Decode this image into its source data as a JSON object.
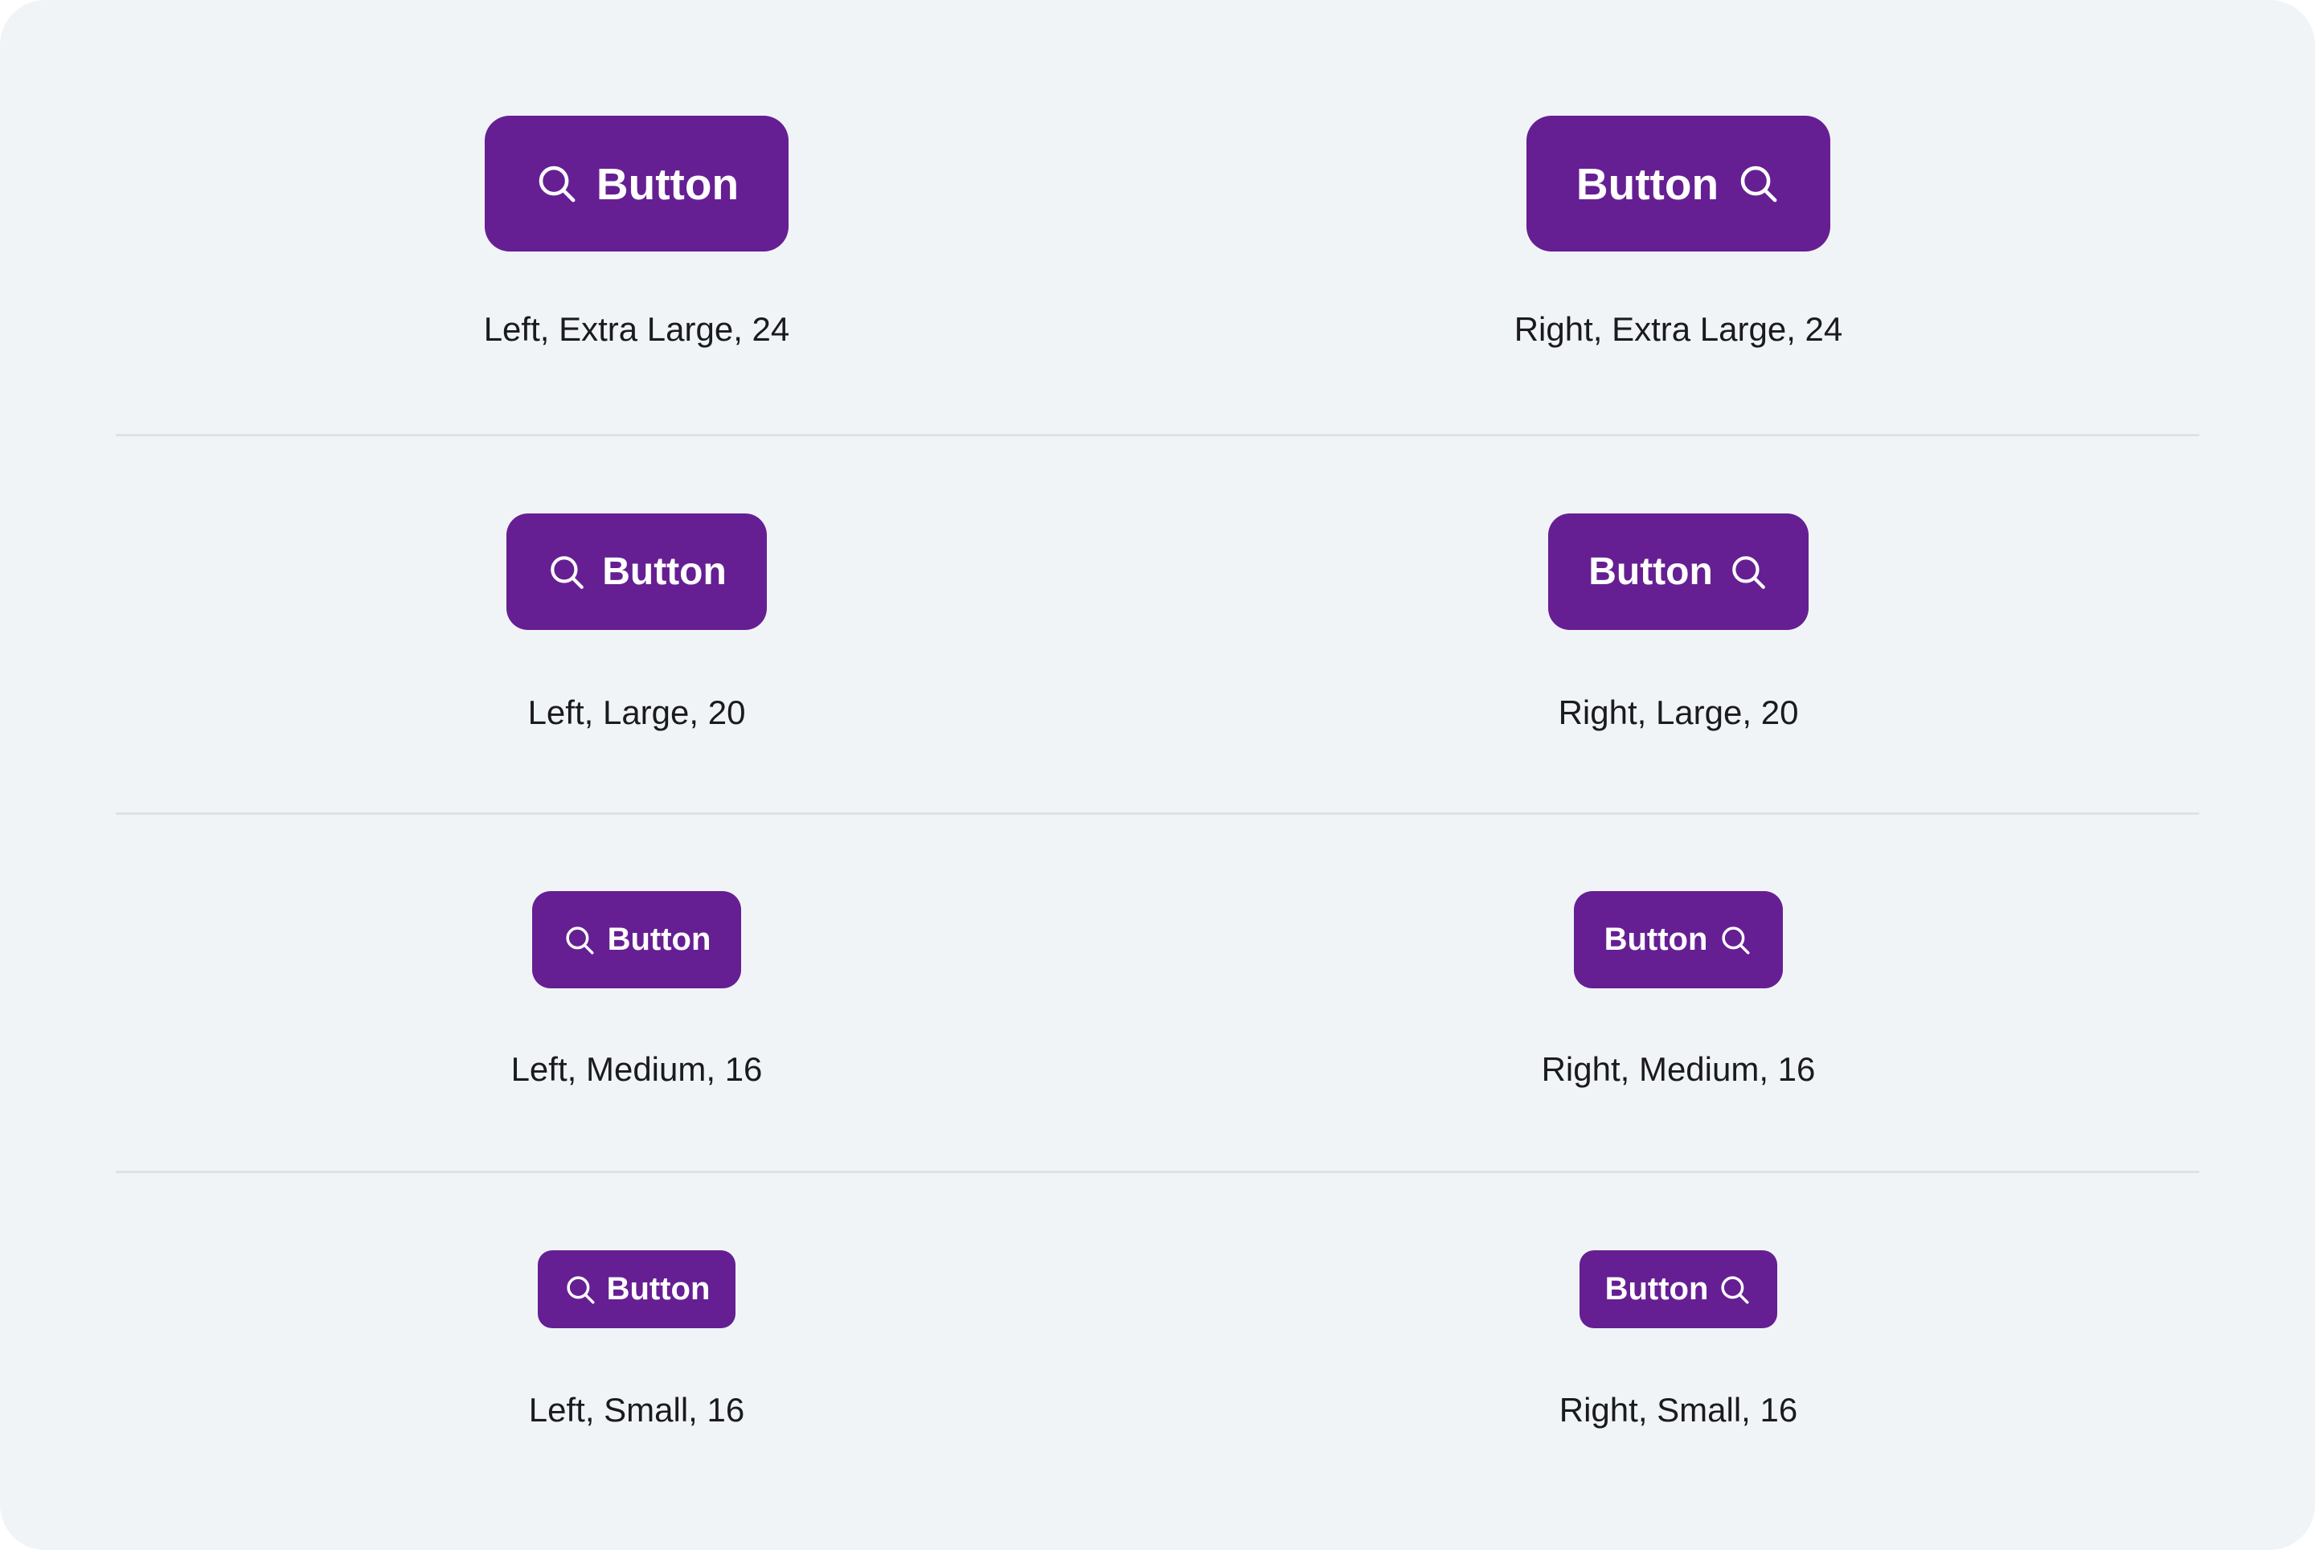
{
  "theme": {
    "button_color": "#661f93",
    "background_color": "#f1f4f7",
    "caption_color": "#1a1a1f",
    "divider_color": "#dde2e8"
  },
  "icon": "search-icon",
  "rows": [
    {
      "left": {
        "icon_position": "left",
        "button_label": "Button",
        "caption": "Left, Extra Large, 24"
      },
      "right": {
        "icon_position": "right",
        "button_label": "Button",
        "caption": "Right, Extra Large, 24"
      }
    },
    {
      "left": {
        "icon_position": "left",
        "button_label": "Button",
        "caption": "Left, Large, 20"
      },
      "right": {
        "icon_position": "right",
        "button_label": "Button",
        "caption": "Right, Large, 20"
      }
    },
    {
      "left": {
        "icon_position": "left",
        "button_label": "Button",
        "caption": "Left, Medium, 16"
      },
      "right": {
        "icon_position": "right",
        "button_label": "Button",
        "caption": "Right, Medium, 16"
      }
    },
    {
      "left": {
        "icon_position": "left",
        "button_label": "Button",
        "caption": "Left, Small, 16"
      },
      "right": {
        "icon_position": "right",
        "button_label": "Button",
        "caption": "Right, Small, 16"
      }
    }
  ]
}
